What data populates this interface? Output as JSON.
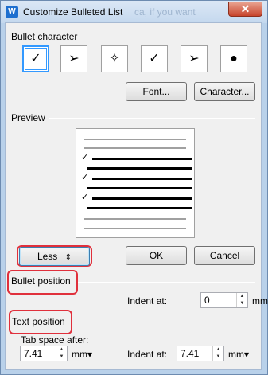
{
  "window": {
    "title": "Customize Bulleted List",
    "app_icon": "W",
    "close_glyph": "✕"
  },
  "bullet_character": {
    "group_label": "Bullet character",
    "bullets": [
      {
        "glyph": "✓",
        "selected": true
      },
      {
        "glyph": "➢",
        "selected": false
      },
      {
        "glyph": "✧",
        "selected": false
      },
      {
        "glyph": "✓",
        "selected": false
      },
      {
        "glyph": "➢",
        "selected": false
      },
      {
        "glyph": "●",
        "selected": false
      }
    ],
    "font_button": "Font...",
    "character_button": "Character..."
  },
  "preview": {
    "group_label": "Preview",
    "check_glyph": "✓"
  },
  "buttons": {
    "less_label": "Less",
    "less_icon": "⇕",
    "ok_label": "OK",
    "cancel_label": "Cancel"
  },
  "bullet_position": {
    "group_label": "Bullet position",
    "indent_label": "Indent at:",
    "indent_value": "0",
    "unit": "mm▾"
  },
  "text_position": {
    "group_label": "Text position",
    "tab_space_label": "Tab space after:",
    "tab_space_value": "7.41",
    "tab_unit": "mm▾",
    "indent_label": "Indent at:",
    "indent_value": "7.41",
    "indent_unit": "mm▾"
  },
  "colors": {
    "highlight_ring": "#e0303c",
    "selection": "#3399ff"
  },
  "background_text_fragment": "ca, if you want"
}
